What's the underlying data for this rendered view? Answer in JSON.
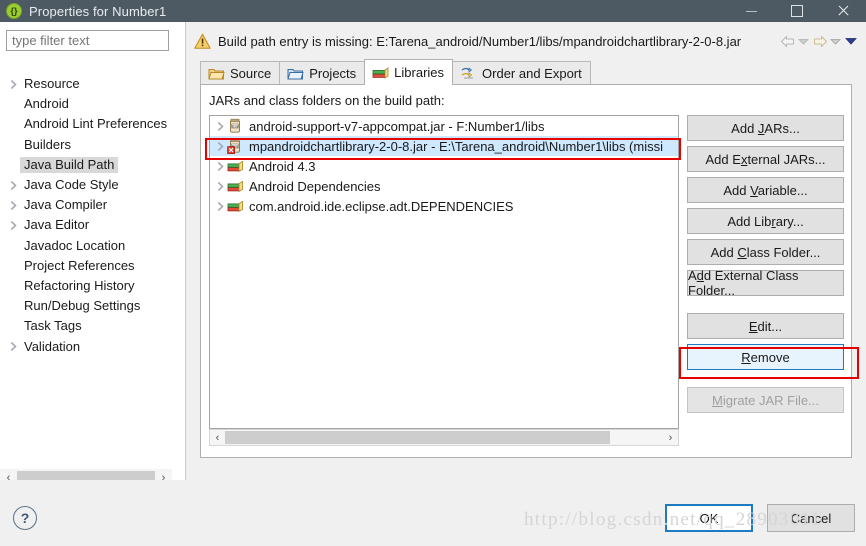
{
  "window": {
    "title": "Properties for Number1",
    "icon": "eclipse-properties-icon",
    "minimize_label": "Minimize",
    "maximize_label": "Maximize",
    "close_label": "Close"
  },
  "sidebar": {
    "filter": {
      "value": "",
      "placeholder": "type filter text"
    },
    "items": [
      {
        "label": "Resource",
        "expandable": true,
        "selected": false
      },
      {
        "label": "Android",
        "expandable": false,
        "selected": false
      },
      {
        "label": "Android Lint Preferences",
        "expandable": false,
        "selected": false
      },
      {
        "label": "Builders",
        "expandable": false,
        "selected": false
      },
      {
        "label": "Java Build Path",
        "expandable": false,
        "selected": true
      },
      {
        "label": "Java Code Style",
        "expandable": true,
        "selected": false
      },
      {
        "label": "Java Compiler",
        "expandable": true,
        "selected": false
      },
      {
        "label": "Java Editor",
        "expandable": true,
        "selected": false
      },
      {
        "label": "Javadoc Location",
        "expandable": false,
        "selected": false
      },
      {
        "label": "Project References",
        "expandable": false,
        "selected": false
      },
      {
        "label": "Refactoring History",
        "expandable": false,
        "selected": false
      },
      {
        "label": "Run/Debug Settings",
        "expandable": false,
        "selected": false
      },
      {
        "label": "Task Tags",
        "expandable": false,
        "selected": false
      },
      {
        "label": "Validation",
        "expandable": true,
        "selected": false
      }
    ]
  },
  "message": {
    "icon": "warning-icon",
    "text": "Build path entry is missing: E:Tarena_android/Number1/libs/mpandroidchartlibrary-2-0-8.jar",
    "nav": {
      "back_label": "Back",
      "back_menu_label": "Back history",
      "forward_label": "Forward",
      "forward_menu_label": "Forward history",
      "menu_label": "View menu"
    }
  },
  "tabs": [
    {
      "label": "Source",
      "icon": "source-folder-icon",
      "active": false
    },
    {
      "label": "Projects",
      "icon": "projects-folder-icon",
      "active": false
    },
    {
      "label": "Libraries",
      "icon": "libraries-books-icon",
      "active": true
    },
    {
      "label": "Order and Export",
      "icon": "order-export-icon",
      "active": false
    }
  ],
  "main": {
    "panel_label": "JARs and class folders on the build path:",
    "entries": [
      {
        "label": "android-support-v7-appcompat.jar - F:Number1/libs",
        "icon": "jar-icon",
        "selected": false,
        "error": false
      },
      {
        "label": "mpandroidchartlibrary-2-0-8.jar - E:\\Tarena_android\\Number1\\libs (missi",
        "icon": "jar-error-icon",
        "selected": true,
        "error": true
      },
      {
        "label": "Android 4.3",
        "icon": "library-icon",
        "selected": false,
        "error": false
      },
      {
        "label": "Android Dependencies",
        "icon": "library-icon",
        "selected": false,
        "error": false
      },
      {
        "label": "com.android.ide.eclipse.adt.DEPENDENCIES",
        "icon": "library-icon",
        "selected": false,
        "error": false
      }
    ],
    "scrollbar": {
      "left_arrow": "‹",
      "right_arrow": "›"
    }
  },
  "actions": [
    {
      "label": "Add JARs...",
      "mnemonic": "J",
      "disabled": false,
      "focused": false,
      "gap_after": false
    },
    {
      "label": "Add External JARs...",
      "mnemonic": "x",
      "disabled": false,
      "focused": false,
      "gap_after": false
    },
    {
      "label": "Add Variable...",
      "mnemonic": "V",
      "disabled": false,
      "focused": false,
      "gap_after": false
    },
    {
      "label": "Add Library...",
      "mnemonic": "r",
      "disabled": false,
      "focused": false,
      "gap_after": false
    },
    {
      "label": "Add Class Folder...",
      "mnemonic": "C",
      "disabled": false,
      "focused": false,
      "gap_after": false
    },
    {
      "label": "Add External Class Folder...",
      "mnemonic": "d",
      "disabled": false,
      "focused": false,
      "gap_after": true
    },
    {
      "label": "Edit...",
      "mnemonic": "E",
      "disabled": false,
      "focused": false,
      "gap_after": false
    },
    {
      "label": "Remove",
      "mnemonic": "R",
      "disabled": false,
      "focused": true,
      "gap_after": true
    },
    {
      "label": "Migrate JAR File...",
      "mnemonic": "M",
      "disabled": true,
      "focused": false,
      "gap_after": false
    }
  ],
  "footer": {
    "help_label": "?",
    "ok_label": "OK",
    "cancel_label": "Cancel"
  },
  "watermark": "http://blog.csdn.net/qq_28903011",
  "colors": {
    "titlebar": "#4d5a63",
    "selection": "#cde8ff",
    "annotation": "#e60000",
    "focus_border": "#1f7ac0",
    "warning": "#f0b323"
  }
}
